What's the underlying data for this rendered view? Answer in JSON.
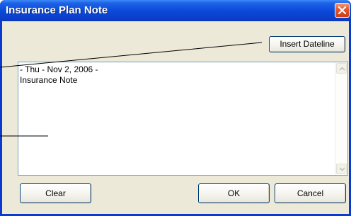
{
  "window": {
    "title": "Insurance Plan Note",
    "close_icon": "close-x-icon"
  },
  "toolbar": {
    "insert_dateline_label": "Insert Dateline"
  },
  "note": {
    "text": "- Thu - Nov 2, 2006 -\nInsurance Note"
  },
  "footer": {
    "clear_label": "Clear",
    "ok_label": "OK",
    "cancel_label": "Cancel"
  },
  "colors": {
    "title_bar": "#0a48d8",
    "dialog_background": "#ece9d8",
    "close_button": "#e2562a",
    "text_border": "#7f9db9"
  }
}
